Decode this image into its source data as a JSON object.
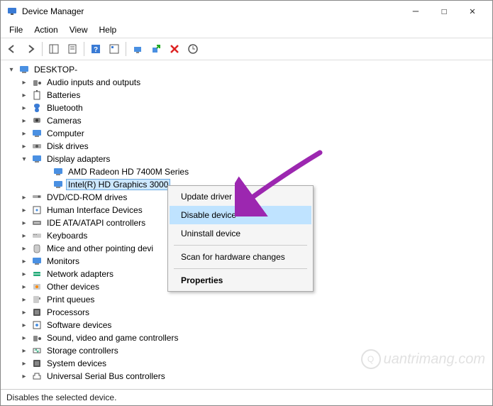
{
  "window": {
    "title": "Device Manager"
  },
  "menubar": {
    "file": "File",
    "action": "Action",
    "view": "View",
    "help": "Help"
  },
  "tree": {
    "root": "DESKTOP-",
    "items": [
      {
        "label": "Audio inputs and outputs"
      },
      {
        "label": "Batteries"
      },
      {
        "label": "Bluetooth"
      },
      {
        "label": "Cameras"
      },
      {
        "label": "Computer"
      },
      {
        "label": "Disk drives"
      },
      {
        "label": "Display adapters",
        "expanded": true
      },
      {
        "label": "DVD/CD-ROM drives"
      },
      {
        "label": "Human Interface Devices"
      },
      {
        "label": "IDE ATA/ATAPI controllers"
      },
      {
        "label": "Keyboards"
      },
      {
        "label": "Mice and other pointing devi"
      },
      {
        "label": "Monitors"
      },
      {
        "label": "Network adapters"
      },
      {
        "label": "Other devices"
      },
      {
        "label": "Print queues"
      },
      {
        "label": "Processors"
      },
      {
        "label": "Software devices"
      },
      {
        "label": "Sound, video and game controllers"
      },
      {
        "label": "Storage controllers"
      },
      {
        "label": "System devices"
      },
      {
        "label": "Universal Serial Bus controllers"
      }
    ],
    "display_children": {
      "amd": "AMD Radeon HD 7400M Series",
      "intel": "Intel(R) HD Graphics 3000"
    }
  },
  "contextmenu": {
    "update": "Update driver",
    "disable": "Disable device",
    "uninstall": "Uninstall device",
    "scan": "Scan for hardware changes",
    "properties": "Properties"
  },
  "statusbar": {
    "text": "Disables the selected device."
  },
  "watermark": {
    "text": "uantrimang.com"
  }
}
